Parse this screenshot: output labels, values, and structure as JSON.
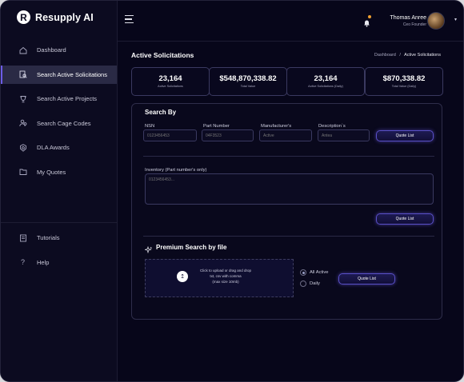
{
  "brand": {
    "name": "Resupply AI",
    "logo_letter": "R"
  },
  "sidebar": {
    "items": [
      {
        "label": "Dashboard",
        "icon": "home-icon",
        "active": false
      },
      {
        "label": "Search Active Solicitations",
        "icon": "search-doc-icon",
        "active": true
      },
      {
        "label": "Search Active Projects",
        "icon": "trophy-icon",
        "active": false
      },
      {
        "label": "Search Cage Codes",
        "icon": "users-icon",
        "active": false
      },
      {
        "label": "DLA Awards",
        "icon": "award-icon",
        "active": false
      },
      {
        "label": "My Quotes",
        "icon": "folder-icon",
        "active": false
      }
    ],
    "bottom": [
      {
        "label": "Tutorials",
        "icon": "book-icon"
      },
      {
        "label": "Help",
        "icon": "question-icon"
      }
    ]
  },
  "topbar": {
    "user_name": "Thomas Anree",
    "user_role": "Ceo Founder",
    "notification_color": "#f0a030"
  },
  "page": {
    "title": "Active Solicitations",
    "breadcrumb": {
      "parent": "Dashboard",
      "separator": "/",
      "current": "Active Solicitations"
    }
  },
  "stats": [
    {
      "value": "23,164",
      "label": "Active Solicitations"
    },
    {
      "value": "$548,870,338.82",
      "label": "Total Value"
    },
    {
      "value": "23,164",
      "label": "Active Solicitations (Daily)"
    },
    {
      "value": "$870,338.82",
      "label": "Total Value (Daily)"
    }
  ],
  "search": {
    "title": "Search By",
    "fields": [
      {
        "label": "NSN",
        "placeholder": "0123456453"
      },
      {
        "label": "Part Number",
        "placeholder": "04F3523"
      },
      {
        "label": "Manufacturer's",
        "placeholder": "Active"
      },
      {
        "label": "Description`s",
        "placeholder": "Antea"
      }
    ],
    "quote_button": "Quote List",
    "inventory_label": "Inventory (Part number's only)",
    "inventory_placeholder": "0123456453...",
    "inventory_button": "Quote List"
  },
  "premium": {
    "title": "Premium Search by file",
    "upload_text_1": "Click to upload or drag and drop",
    "upload_text_2": "txt, csv with comma",
    "upload_text_3": "(max size 10mb)",
    "options": [
      {
        "label": "All Active",
        "checked": true
      },
      {
        "label": "Daily",
        "checked": false
      }
    ],
    "button": "Quote List"
  },
  "colors": {
    "accent": "#6c5ce7",
    "background": "#07061a",
    "sidebar": "#0c0b20"
  }
}
